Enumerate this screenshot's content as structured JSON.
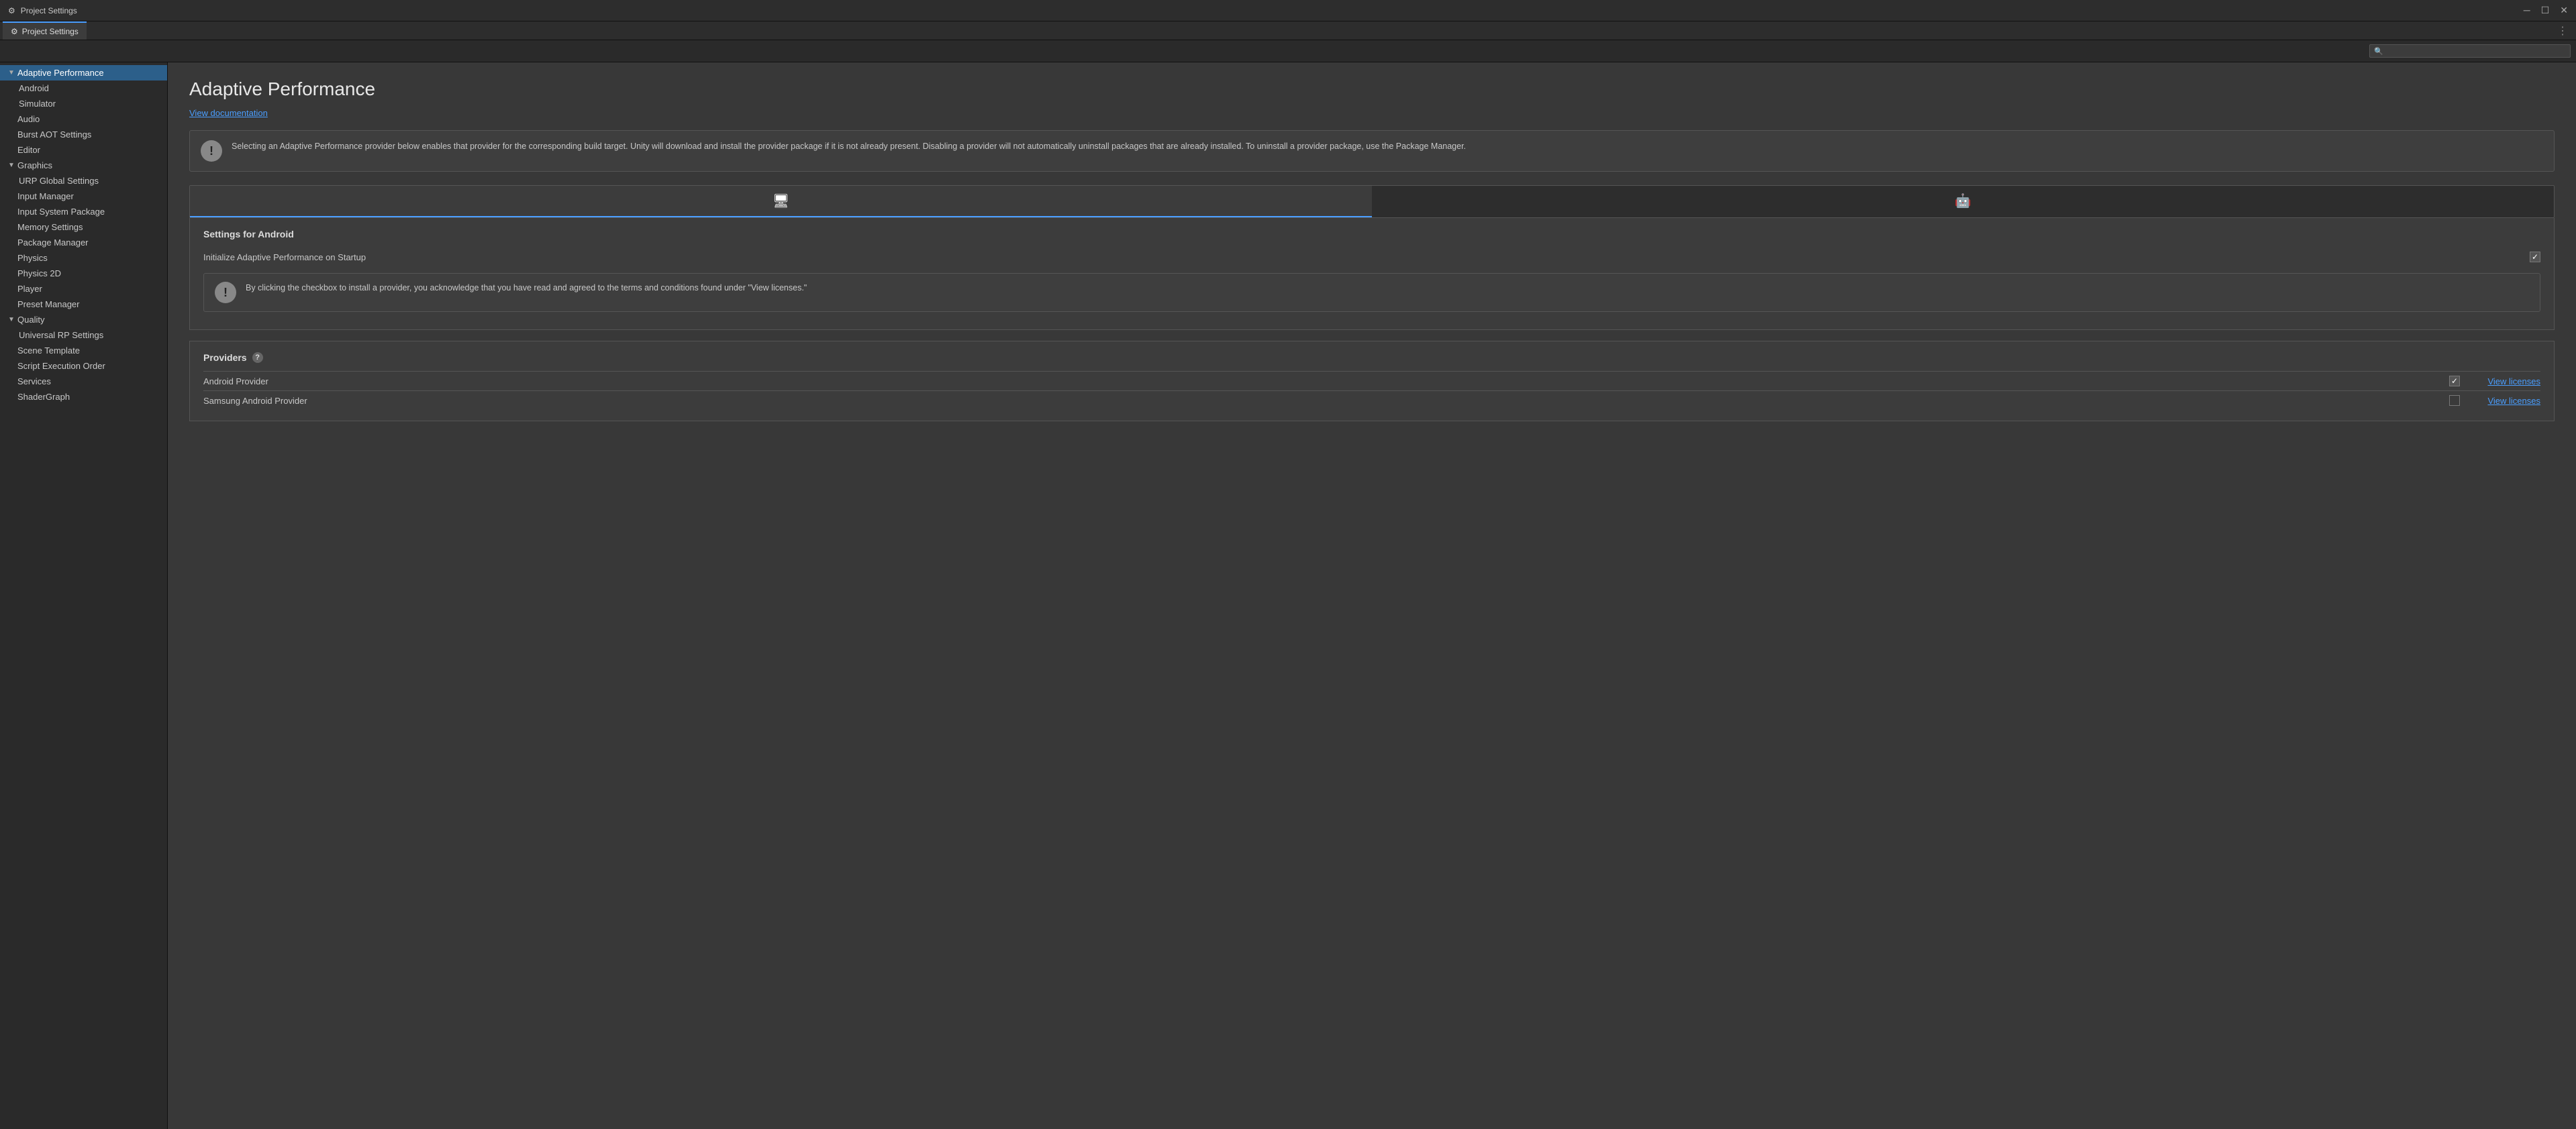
{
  "titleBar": {
    "icon": "⚙",
    "title": "Project Settings",
    "controls": [
      "─",
      "☐",
      "✕"
    ]
  },
  "tab": {
    "icon": "⚙",
    "label": "Project Settings",
    "menuBtn": "⋮"
  },
  "search": {
    "placeholder": "",
    "icon": "🔍"
  },
  "sidebar": {
    "items": [
      {
        "id": "adaptive-performance",
        "label": "Adaptive Performance",
        "level": 0,
        "hasArrow": true,
        "expanded": true,
        "active": true
      },
      {
        "id": "android",
        "label": "Android",
        "level": 1,
        "hasArrow": false,
        "active": false
      },
      {
        "id": "simulator",
        "label": "Simulator",
        "level": 1,
        "hasArrow": false,
        "active": false
      },
      {
        "id": "audio",
        "label": "Audio",
        "level": 0,
        "hasArrow": false,
        "active": false
      },
      {
        "id": "burst-aot-settings",
        "label": "Burst AOT Settings",
        "level": 0,
        "hasArrow": false,
        "active": false
      },
      {
        "id": "editor",
        "label": "Editor",
        "level": 0,
        "hasArrow": false,
        "active": false
      },
      {
        "id": "graphics",
        "label": "Graphics",
        "level": 0,
        "hasArrow": true,
        "expanded": true,
        "active": false
      },
      {
        "id": "urp-global-settings",
        "label": "URP Global Settings",
        "level": 1,
        "hasArrow": false,
        "active": false
      },
      {
        "id": "input-manager",
        "label": "Input Manager",
        "level": 0,
        "hasArrow": false,
        "active": false
      },
      {
        "id": "input-system-package",
        "label": "Input System Package",
        "level": 0,
        "hasArrow": false,
        "active": false
      },
      {
        "id": "memory-settings",
        "label": "Memory Settings",
        "level": 0,
        "hasArrow": false,
        "active": false
      },
      {
        "id": "package-manager",
        "label": "Package Manager",
        "level": 0,
        "hasArrow": false,
        "active": false
      },
      {
        "id": "physics",
        "label": "Physics",
        "level": 0,
        "hasArrow": false,
        "active": false
      },
      {
        "id": "physics-2d",
        "label": "Physics 2D",
        "level": 0,
        "hasArrow": false,
        "active": false
      },
      {
        "id": "player",
        "label": "Player",
        "level": 0,
        "hasArrow": false,
        "active": false
      },
      {
        "id": "preset-manager",
        "label": "Preset Manager",
        "level": 0,
        "hasArrow": false,
        "active": false
      },
      {
        "id": "quality",
        "label": "Quality",
        "level": 0,
        "hasArrow": true,
        "expanded": true,
        "active": false
      },
      {
        "id": "universal-rp-settings",
        "label": "Universal RP Settings",
        "level": 1,
        "hasArrow": false,
        "active": false
      },
      {
        "id": "scene-template",
        "label": "Scene Template",
        "level": 0,
        "hasArrow": false,
        "active": false
      },
      {
        "id": "script-execution-order",
        "label": "Script Execution Order",
        "level": 0,
        "hasArrow": false,
        "active": false
      },
      {
        "id": "services",
        "label": "Services",
        "level": 0,
        "hasArrow": false,
        "active": false
      },
      {
        "id": "shadergraph",
        "label": "ShaderGraph",
        "level": 0,
        "hasArrow": false,
        "active": false
      }
    ]
  },
  "content": {
    "title": "Adaptive Performance",
    "viewDocumentationLabel": "View documentation",
    "infoMessage": "Selecting an Adaptive Performance provider below enables that provider for the corresponding build target. Unity will download and install the provider package if it is not already present. Disabling a provider will not automatically uninstall packages that are already installed. To uninstall a provider package, use the Package Manager.",
    "platformTabs": [
      {
        "id": "desktop",
        "icon": "🖥",
        "label": "Desktop",
        "active": true
      },
      {
        "id": "android",
        "icon": "🤖",
        "label": "Android",
        "active": false
      }
    ],
    "settingsForAndroid": {
      "title": "Settings for Android",
      "settings": [
        {
          "label": "Initialize Adaptive Performance on Startup",
          "checked": true
        }
      ]
    },
    "warningMessage": "By clicking the checkbox to install a provider, you acknowledge that you have read and agreed to the terms and conditions found under \"View licenses.\"",
    "providers": {
      "title": "Providers",
      "helpTooltip": "?",
      "items": [
        {
          "name": "Android Provider",
          "checked": true,
          "viewLicensesLabel": "View licenses"
        },
        {
          "name": "Samsung Android Provider",
          "checked": false,
          "viewLicensesLabel": "View licenses"
        }
      ]
    }
  }
}
